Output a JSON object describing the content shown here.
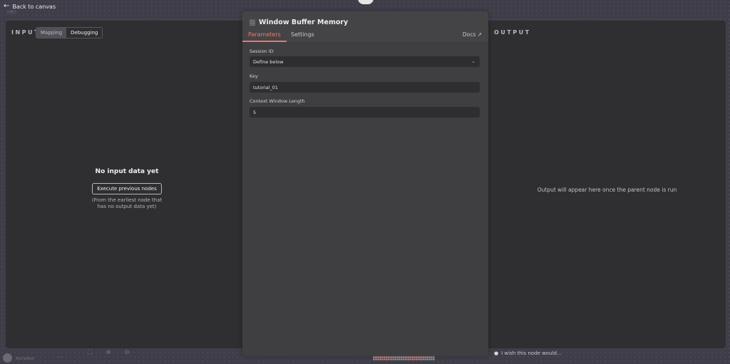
{
  "nav": {
    "back_label": "Back to canvas",
    "logo_text": "n8n"
  },
  "input_panel": {
    "label": "INPUT",
    "modes": [
      {
        "label": "Mapping",
        "active": false
      },
      {
        "label": "Debugging",
        "active": true
      }
    ],
    "empty_title": "No input data yet",
    "execute_button": "Execute previous nodes",
    "hint": "(From the earliest node that has no output data yet)"
  },
  "node": {
    "title": "Window Buffer Memory",
    "icon": "memory-icon",
    "tabs": [
      {
        "label": "Parameters",
        "active": true
      },
      {
        "label": "Settings",
        "active": false
      }
    ],
    "docs_label": "Docs",
    "fields": {
      "session_id": {
        "label": "Session ID",
        "value": "Define below"
      },
      "key": {
        "label": "Key",
        "value": "tutorial_01"
      },
      "context_window_length": {
        "label": "Context Window Length",
        "value": "5"
      }
    },
    "accent_color": "#e8796d"
  },
  "output_panel": {
    "label": "OUTPUT",
    "message": "Output will appear here once the parent node is run"
  },
  "footer": {
    "user_name": "Azradex",
    "more": "...",
    "wish_label": "I wish this node would..."
  }
}
